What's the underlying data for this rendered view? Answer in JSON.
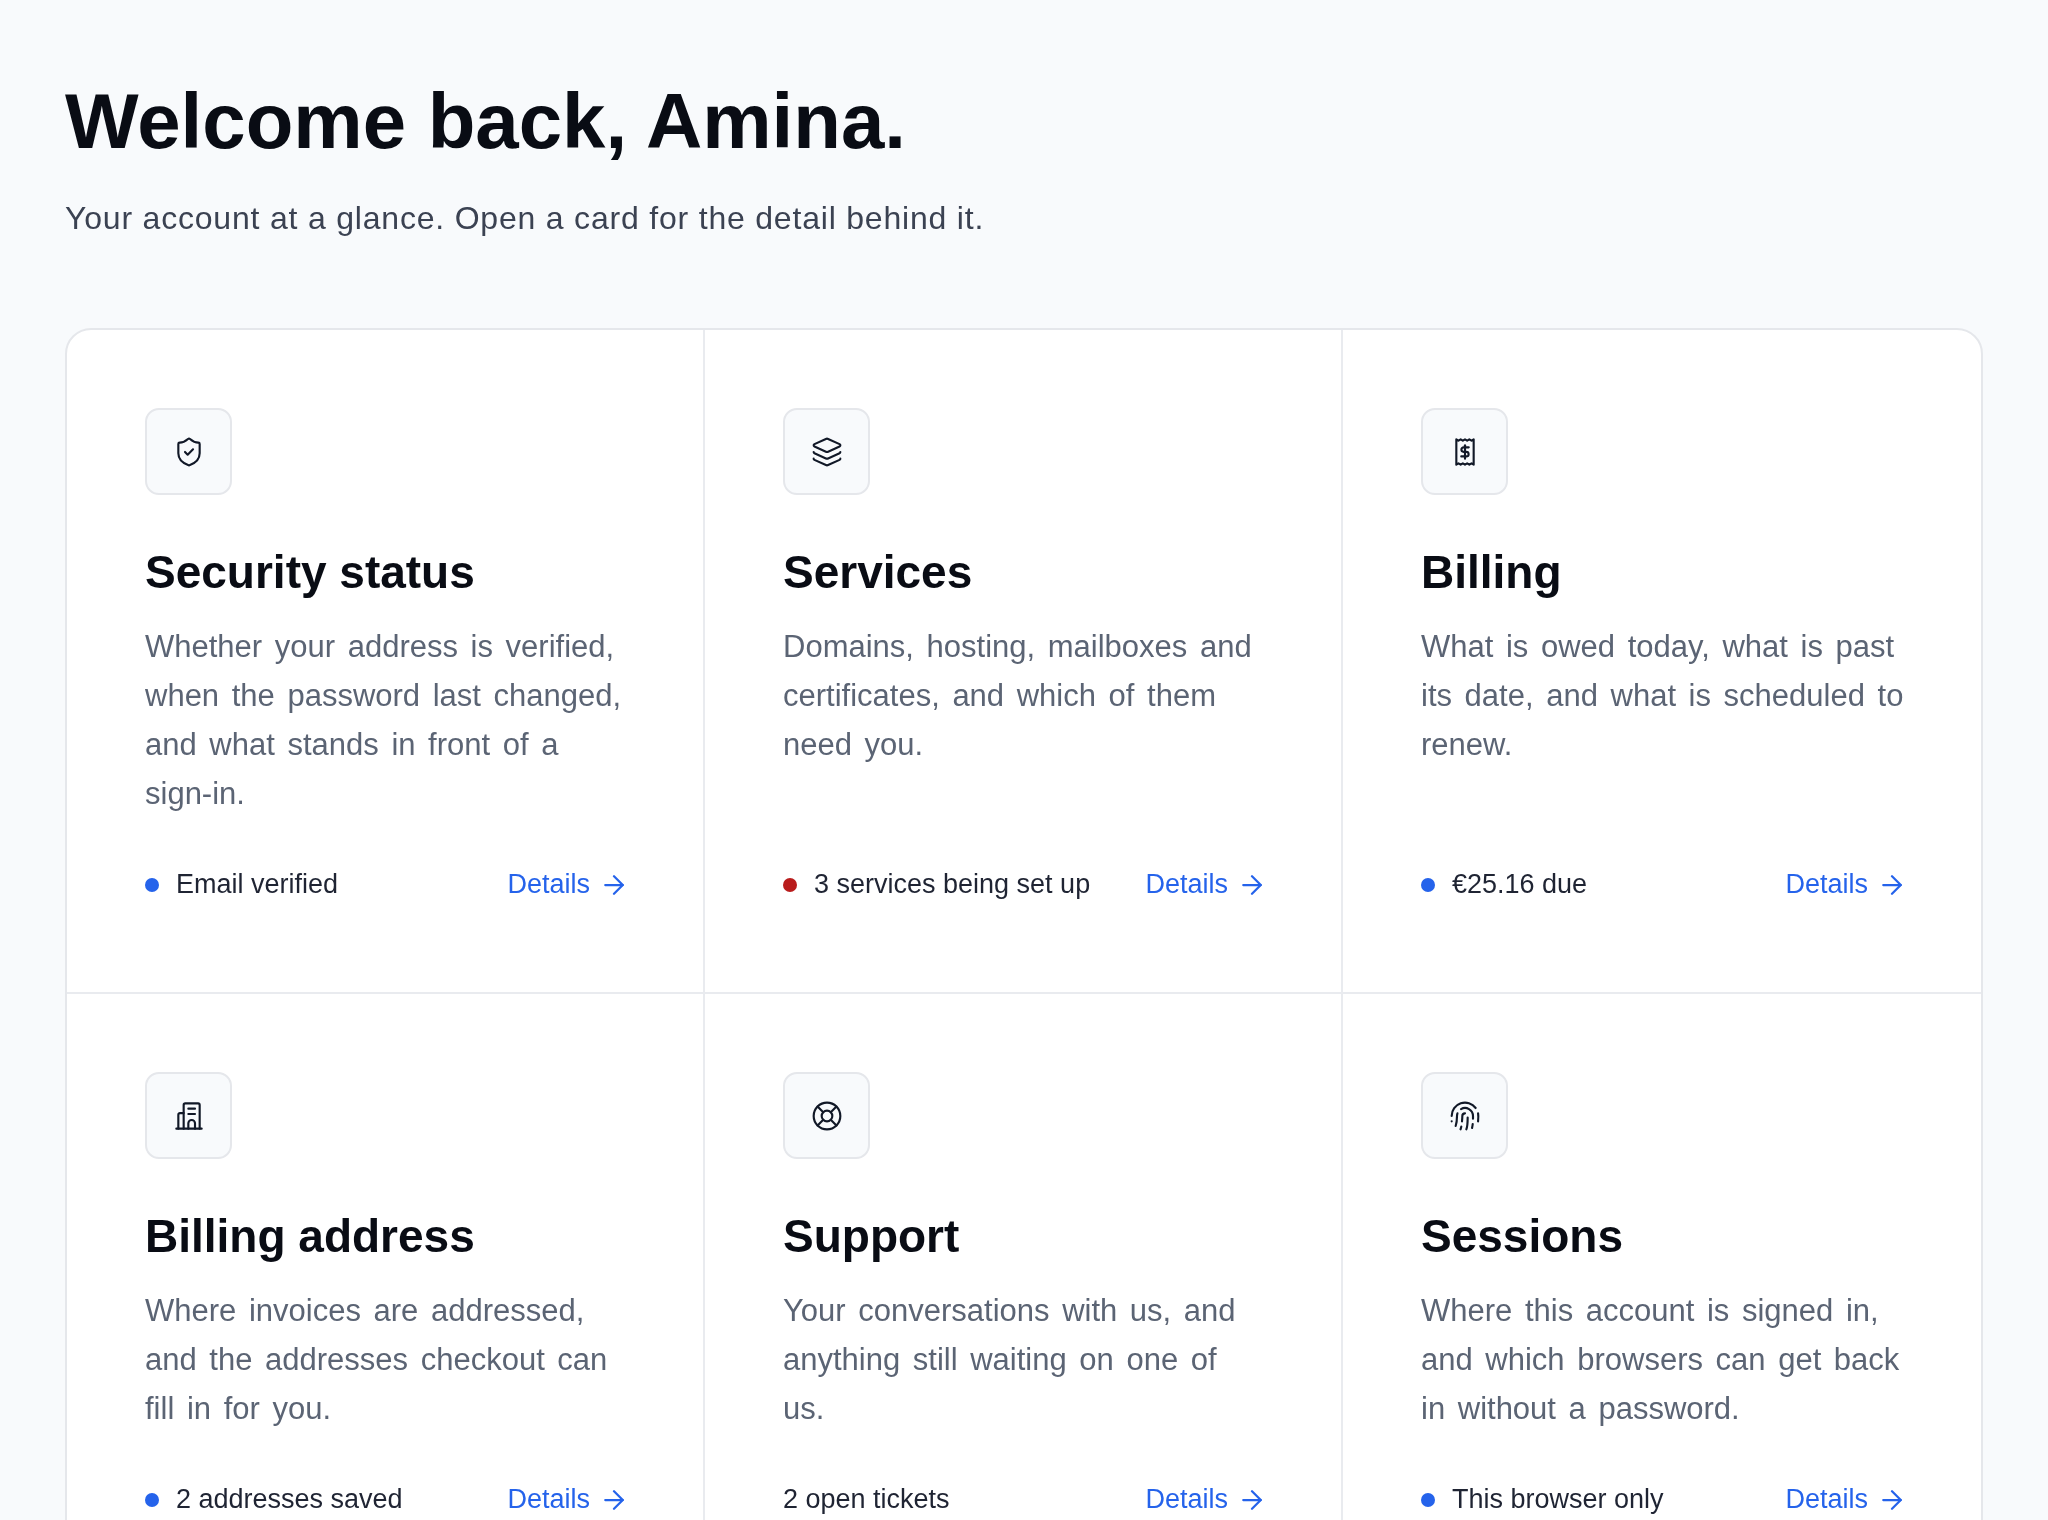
{
  "header": {
    "title": "Welcome back, Amina.",
    "subtitle": "Your account at a glance. Open a card for the detail behind it."
  },
  "cards": [
    {
      "title": "Security status",
      "description": "Whether your address is verified, when the password last changed, and what stands in front of a sign-in.",
      "status": {
        "text": "Email verified",
        "color": "#2563eb"
      },
      "link": "Details"
    },
    {
      "title": "Services",
      "description": "Domains, hosting, mailboxes and certificates, and which of them need you.",
      "status": {
        "text": "3 services being set up",
        "color": "#b91c1c"
      },
      "link": "Details"
    },
    {
      "title": "Billing",
      "description": "What is owed today, what is past its date, and what is scheduled to renew.",
      "status": {
        "text": "€25.16 due",
        "color": "#2563eb"
      },
      "link": "Details"
    },
    {
      "title": "Billing address",
      "description": "Where invoices are addressed, and the addresses checkout can fill in for you.",
      "status": {
        "text": "2 addresses saved",
        "color": "#2563eb"
      },
      "link": "Details"
    },
    {
      "title": "Support",
      "description": "Your conversations with us, and anything still waiting on one of us.",
      "status": {
        "text": "2 open tickets"
      },
      "link": "Details"
    },
    {
      "title": "Sessions",
      "description": "Where this account is signed in, and which browsers can get back in without a password.",
      "status": {
        "text": "This browser only",
        "color": "#2563eb"
      },
      "link": "Details"
    }
  ]
}
